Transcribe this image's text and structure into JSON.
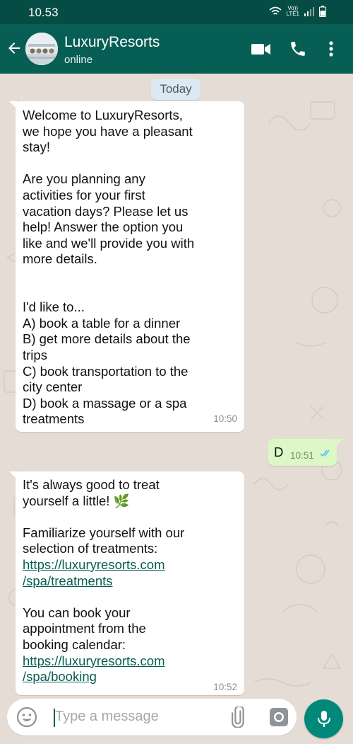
{
  "status_bar": {
    "time": "10.53",
    "network_label_top": "Vo))",
    "network_label_bottom": "LTE1"
  },
  "header": {
    "contact_name": "LuxuryResorts",
    "status": "online"
  },
  "chat": {
    "date_chip": "Today",
    "messages": [
      {
        "direction": "incoming",
        "text": "Welcome to LuxuryResorts,\nwe hope you have a pleasant\nstay!\n\nAre you planning any\nactivities for your first\nvacation days? Please let us\nhelp! Answer the option you\nlike and we'll provide you with\nmore details.\n\n\nI'd like to...\nA) book a table for a dinner\nB) get more details about the\ntrips\nC) book transportation to the\ncity center\nD) book a massage or a spa\ntreatments",
        "time": "10:50"
      },
      {
        "direction": "outgoing",
        "text": "D",
        "time": "10:51",
        "read_receipt": "double-check-icon",
        "receipt_color": "#4fc3f7"
      },
      {
        "direction": "incoming",
        "text_1": "It's always good to treat\nyourself a little! 🌿",
        "text_2": "Familiarize yourself with our\nselection of treatments:",
        "link_1": {
          "line1": "https://luxuryresorts.com",
          "line2": "/spa/treatments"
        },
        "text_3": "You can book your\nappointment from the\nbooking calendar:",
        "link_2": {
          "line1": "https://luxuryresorts.com",
          "line2": "/spa/booking"
        },
        "time": "10:52"
      }
    ]
  },
  "composer": {
    "placeholder": "Type a message"
  },
  "colors": {
    "header": "#075e54",
    "status_bar": "#054d44",
    "outgoing_bubble": "#dcf8c6",
    "chat_background": "#e5ddd5",
    "link": "#075e54",
    "mic_button": "#00897b"
  }
}
